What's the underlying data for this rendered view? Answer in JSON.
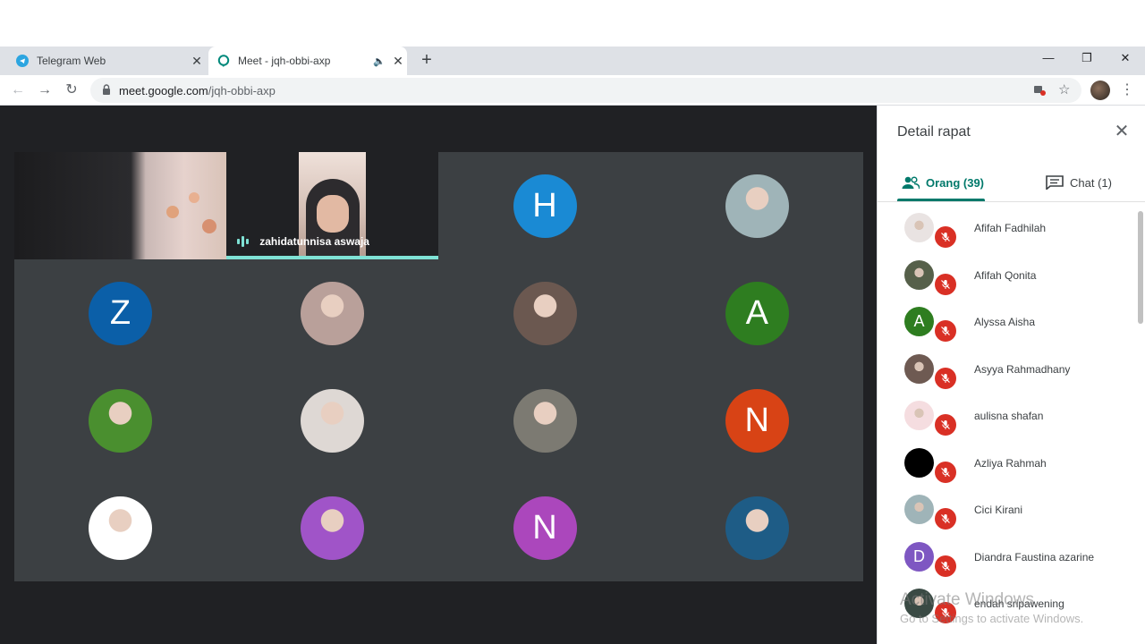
{
  "browser": {
    "tabs": [
      {
        "title": "Telegram Web",
        "close": "✕"
      },
      {
        "title": "Meet - jqh-obbi-axp",
        "close": "✕"
      }
    ],
    "new_tab": "+",
    "window_controls": {
      "minimize": "—",
      "maximize": "❐",
      "close": "✕"
    },
    "url_host": "meet.google.com",
    "url_path": "/jqh-obbi-axp",
    "icons": {
      "back": "back-arrow-icon",
      "forward": "forward-arrow-icon",
      "reload": "reload-icon",
      "lock": "lock-icon",
      "star": "star-icon",
      "menu": "kebab-menu-icon"
    }
  },
  "meeting": {
    "active_speaker": "zahidatunnisa aswaja",
    "tiles": [
      {
        "type": "video"
      },
      {
        "type": "video-speaking"
      },
      {
        "type": "letter",
        "letter": "H",
        "color": "#1a8ad4"
      },
      {
        "type": "photo",
        "color": "#9fb4b8"
      },
      {
        "type": "letter",
        "letter": "Z",
        "color": "#0b5fa8"
      },
      {
        "type": "photo",
        "color": "#b9a09a"
      },
      {
        "type": "photo",
        "color": "#6b5850"
      },
      {
        "type": "letter",
        "letter": "A",
        "color": "#2e7d20"
      },
      {
        "type": "photo",
        "color": "#4a8f2f"
      },
      {
        "type": "photo",
        "color": "#ded8d4"
      },
      {
        "type": "photo",
        "color": "#7c7a72"
      },
      {
        "type": "letter",
        "letter": "N",
        "color": "#d84315"
      },
      {
        "type": "photo",
        "color": "#ffffff"
      },
      {
        "type": "photo",
        "color": "#a054c8"
      },
      {
        "type": "letter",
        "letter": "N",
        "color": "#ab47bc"
      },
      {
        "type": "photo",
        "color": "#1e5c86"
      }
    ]
  },
  "panel": {
    "title": "Detail rapat",
    "tab_people": "Orang (39)",
    "tab_chat": "Chat (1)",
    "participants": [
      {
        "name": "Afifah Fadhilah",
        "avatar": "photo",
        "color": "#e9e3e2"
      },
      {
        "name": "Afifah Qonita",
        "avatar": "photo",
        "color": "#56604a"
      },
      {
        "name": "Alyssa Aisha",
        "avatar": "letter",
        "letter": "A",
        "color": "#2e7d20"
      },
      {
        "name": "Asyya Rahmadhany",
        "avatar": "photo",
        "color": "#6e5a52"
      },
      {
        "name": "aulisna shafan",
        "avatar": "photo",
        "color": "#f5dde0"
      },
      {
        "name": "Azliya Rahmah",
        "avatar": "photo",
        "color": "#000000"
      },
      {
        "name": "Cici Kirani",
        "avatar": "photo",
        "color": "#9fb4b8"
      },
      {
        "name": "Diandra Faustina azarine",
        "avatar": "letter",
        "letter": "D",
        "color": "#7e57c2"
      },
      {
        "name": "endah sripawening",
        "avatar": "photo",
        "color": "#3a4a44"
      }
    ]
  },
  "watermark": {
    "line1": "Activate Windows",
    "line2": "Go to Settings to activate Windows."
  }
}
